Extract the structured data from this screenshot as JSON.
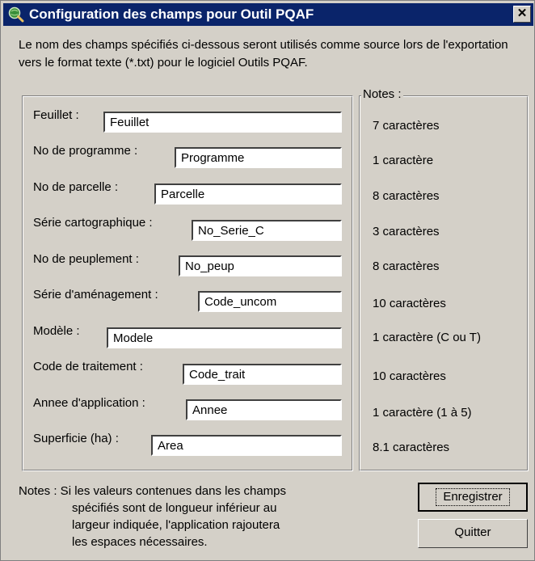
{
  "window": {
    "title": "Configuration des champs pour Outil PQAF",
    "close_label": "✕"
  },
  "intro_text": "Le nom des champs spécifiés ci-dessous seront utilisés comme source lors de l'exportation vers le format texte (*.txt) pour le logiciel Outils PQAF.",
  "notes_legend": "Notes :",
  "fields": [
    {
      "label": "Feuillet :",
      "value": "Feuillet",
      "note": "7  caractères"
    },
    {
      "label": "No de programme :",
      "value": "Programme",
      "note": "1  caractère"
    },
    {
      "label": "No de parcelle :",
      "value": "Parcelle",
      "note": "8  caractères"
    },
    {
      "label": "Série cartographique :",
      "value": "No_Serie_C",
      "note": "3  caractères"
    },
    {
      "label": "No de peuplement :",
      "value": "No_peup",
      "note": "8  caractères"
    },
    {
      "label": "Série d'aménagement :",
      "value": "Code_uncom",
      "note": "10  caractères"
    },
    {
      "label": "Modèle :",
      "value": "Modele",
      "note": "1  caractère (C ou T)"
    },
    {
      "label": "Code de traitement :",
      "value": "Code_trait",
      "note": "10  caractères"
    },
    {
      "label": "Annee d'application :",
      "value": "Annee",
      "note": "1  caractère (1 à 5)"
    },
    {
      "label": "Superficie (ha) :",
      "value": "Area",
      "note": "8.1  caractères"
    }
  ],
  "bottom_note": {
    "line1": "Notes : Si les valeurs contenues dans les champs",
    "line2": "spécifiés sont de longueur inférieur au",
    "line3": "largeur indiquée, l'application rajoutera",
    "line4": "les espaces nécessaires."
  },
  "buttons": {
    "save_label": "Enregistrer",
    "quit_label": "Quitter"
  },
  "icons": {
    "app": "globe-magnifier-icon"
  }
}
